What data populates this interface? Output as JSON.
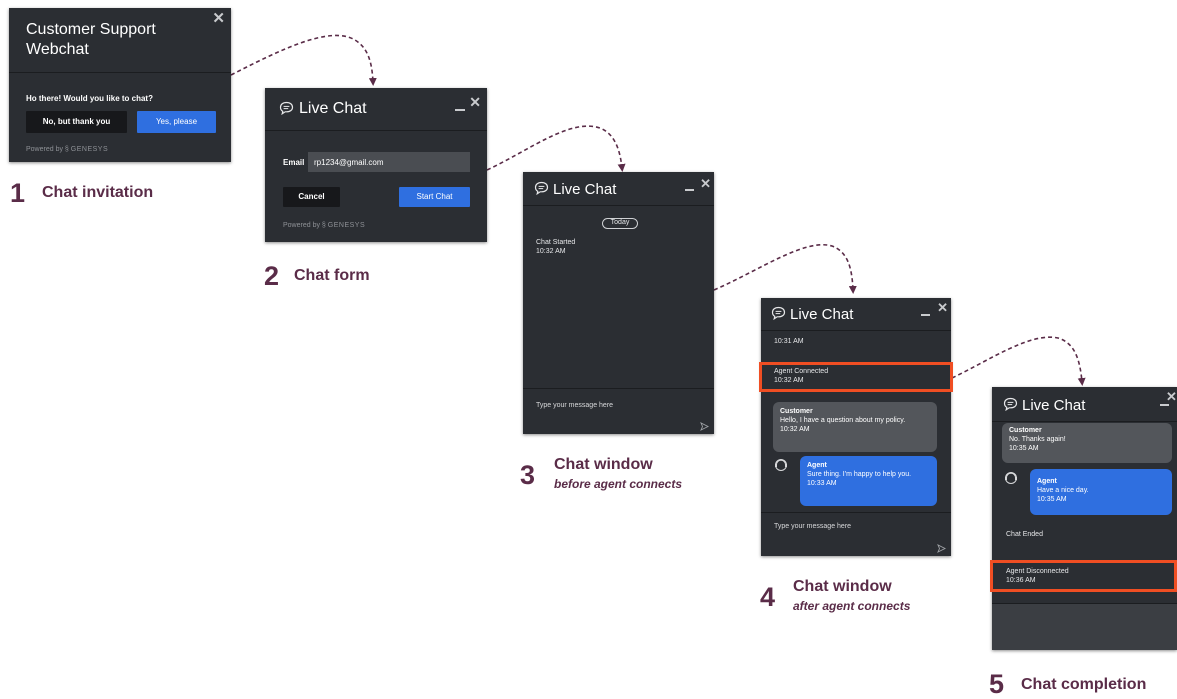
{
  "steps": [
    {
      "num": "1",
      "title": "Chat invitation",
      "sub": ""
    },
    {
      "num": "2",
      "title": "Chat form",
      "sub": ""
    },
    {
      "num": "3",
      "title": "Chat window",
      "sub": "before agent connects"
    },
    {
      "num": "4",
      "title": "Chat window",
      "sub": "after agent connects"
    },
    {
      "num": "5",
      "title": "Chat completion",
      "sub": ""
    }
  ],
  "invitation": {
    "title_line1": "Customer Support",
    "title_line2": "Webchat",
    "prompt": "Ho there! Would you like to chat?",
    "decline_label": "No, but thank you",
    "accept_label": "Yes, please",
    "powered_by": "Powered by",
    "brand": "GENESYS"
  },
  "form": {
    "title": "Live Chat",
    "email_label": "Email",
    "email_value": "rp1234@gmail.com",
    "cancel_label": "Cancel",
    "start_label": "Start Chat",
    "powered_by": "Powered by",
    "brand": "GENESYS"
  },
  "window_before": {
    "title": "Live Chat",
    "date_pill": "Today",
    "system_message": "Chat Started",
    "system_time": "10:32 AM",
    "composer_placeholder": "Type your message here"
  },
  "window_after": {
    "title": "Live Chat",
    "partial_time": "10:31 AM",
    "agent_connected": "Agent Connected",
    "agent_connected_time": "10:32 AM",
    "customer_name": "Customer",
    "customer_text": "Hello, I have a question about my policy.",
    "customer_time": "10:32 AM",
    "agent_name": "Agent",
    "agent_text": "Sure thing. I'm happy to help you.",
    "agent_time": "10:33 AM",
    "composer_placeholder": "Type your message here"
  },
  "window_completion": {
    "title": "Live Chat",
    "customer_name": "Customer",
    "customer_text": "No. Thanks again!",
    "customer_time": "10:35 AM",
    "agent_name": "Agent",
    "agent_text": "Have a nice day.",
    "agent_time": "10:35 AM",
    "chat_ended": "Chat Ended",
    "agent_disconnected": "Agent Disconnected",
    "agent_disconnected_time": "10:36 AM"
  },
  "colors": {
    "panel": "#2b2e33",
    "accent_blue": "#2f6fe0",
    "highlight": "#f04e23",
    "step_text": "#5a2c48",
    "connector": "#5a2c48"
  },
  "icons": [
    "close-icon",
    "minimize-icon",
    "chat-bubble-icon",
    "genesys-logo-icon",
    "send-icon",
    "agent-avatar-icon"
  ]
}
